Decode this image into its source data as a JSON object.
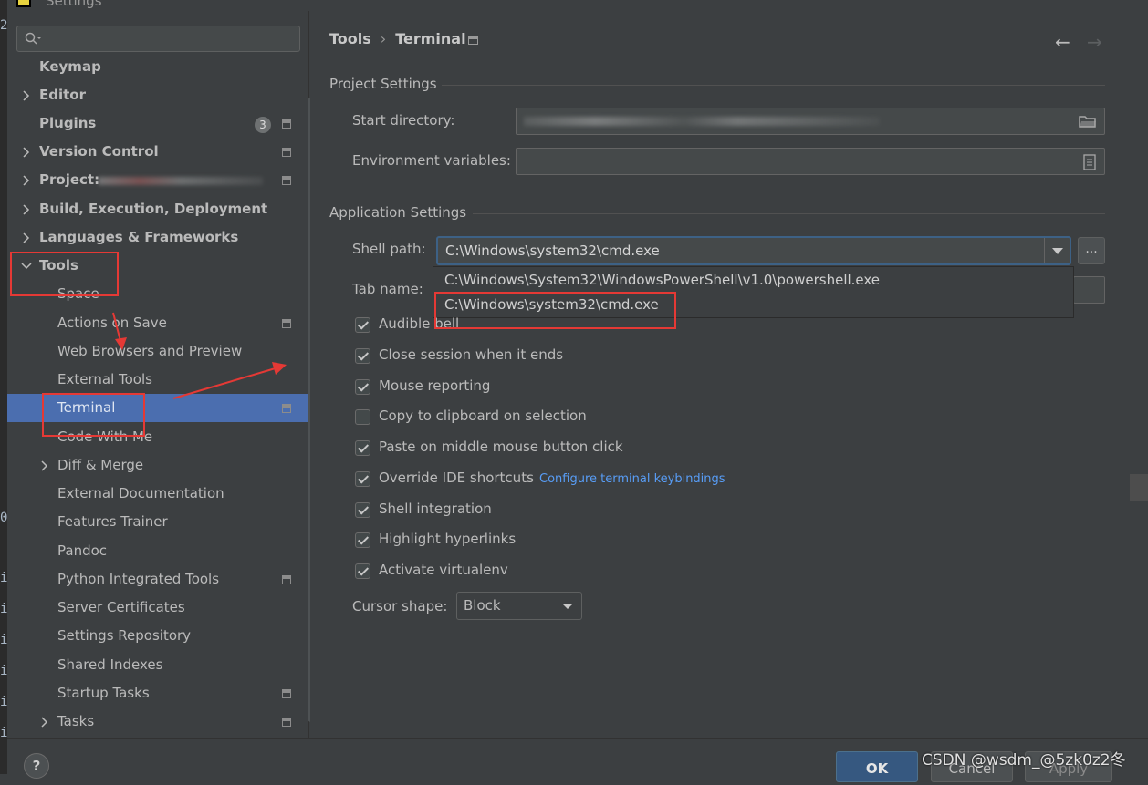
{
  "window": {
    "title": "Settings"
  },
  "sidebar": {
    "search_placeholder": "",
    "items": [
      {
        "label": "Keymap"
      },
      {
        "label": "Editor"
      },
      {
        "label": "Plugins",
        "badge": "3"
      },
      {
        "label": "Version Control"
      },
      {
        "label": "Project: "
      },
      {
        "label": "Build, Execution, Deployment"
      },
      {
        "label": "Languages & Frameworks"
      },
      {
        "label": "Tools"
      },
      {
        "label": "Space"
      },
      {
        "label": "Actions on Save"
      },
      {
        "label": "Web Browsers and Preview"
      },
      {
        "label": "External Tools"
      },
      {
        "label": "Terminal"
      },
      {
        "label": "Code With Me"
      },
      {
        "label": "Diff & Merge"
      },
      {
        "label": "External Documentation"
      },
      {
        "label": "Features Trainer"
      },
      {
        "label": "Pandoc"
      },
      {
        "label": "Python Integrated Tools"
      },
      {
        "label": "Server Certificates"
      },
      {
        "label": "Settings Repository"
      },
      {
        "label": "Shared Indexes"
      },
      {
        "label": "Startup Tasks"
      },
      {
        "label": "Tasks"
      }
    ]
  },
  "breadcrumb": {
    "parent": "Tools",
    "sep": "›",
    "current": "Terminal"
  },
  "project_settings": {
    "title": "Project Settings",
    "start_directory_label": "Start directory:",
    "environment_variables_label": "Environment variables:"
  },
  "application_settings": {
    "title": "Application Settings",
    "shell_path_label": "Shell path:",
    "shell_path_value": "C:\\Windows\\system32\\cmd.exe",
    "shell_options": [
      "C:\\Windows\\System32\\WindowsPowerShell\\v1.0\\powershell.exe",
      "C:\\Windows\\system32\\cmd.exe"
    ],
    "tab_name_label": "Tab name:",
    "checkboxes": [
      {
        "label": "Audible bell",
        "checked": true
      },
      {
        "label": "Close session when it ends",
        "checked": true
      },
      {
        "label": "Mouse reporting",
        "checked": true
      },
      {
        "label": "Copy to clipboard on selection",
        "checked": false
      },
      {
        "label": "Paste on middle mouse button click",
        "checked": true
      },
      {
        "label": "Override IDE shortcuts",
        "checked": true
      },
      {
        "label": "Shell integration",
        "checked": true
      },
      {
        "label": "Highlight hyperlinks",
        "checked": true
      },
      {
        "label": "Activate virtualenv",
        "checked": true
      }
    ],
    "configure_link": "Configure terminal keybindings",
    "cursor_shape_label": "Cursor shape:",
    "cursor_shape_value": "Block"
  },
  "footer": {
    "help": "?",
    "ok": "OK",
    "cancel": "Cancel",
    "apply": "Apply",
    "watermark": "CSDN @wsdm_@5zk0z2冬"
  },
  "colors": {
    "selection": "#4b6eaf",
    "annotation_red": "#e53935",
    "link": "#589df6",
    "ok_button": "#365880"
  }
}
